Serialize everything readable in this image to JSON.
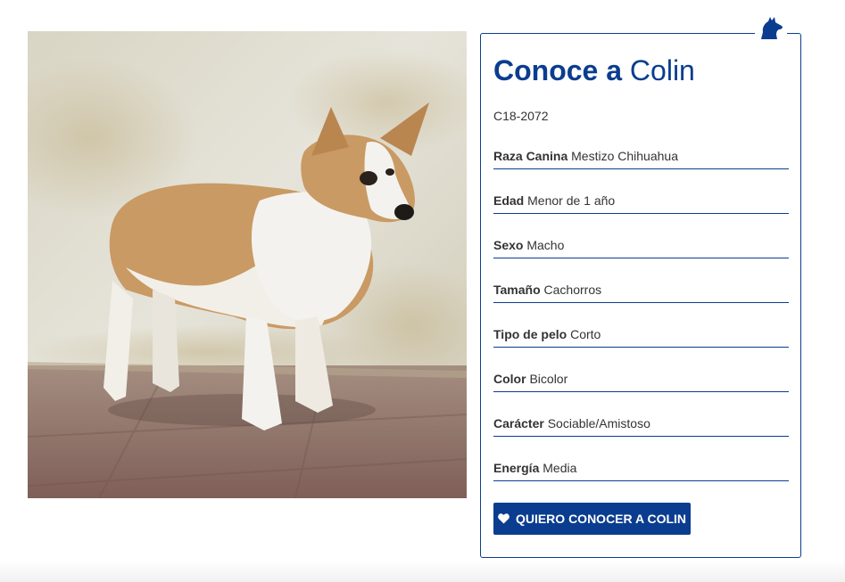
{
  "page": {
    "title_bold": "Conoce a",
    "title_name": "Colin",
    "code": "C18-2072"
  },
  "photo": {
    "subject": "dog-photo"
  },
  "attributes": [
    {
      "key": "Raza Canina",
      "value": "Mestizo Chihuahua"
    },
    {
      "key": "Edad",
      "value": "Menor de 1 año"
    },
    {
      "key": "Sexo",
      "value": "Macho"
    },
    {
      "key": "Tamaño",
      "value": "Cachorros"
    },
    {
      "key": "Tipo de pelo",
      "value": "Corto"
    },
    {
      "key": "Color",
      "value": "Bicolor"
    },
    {
      "key": "Carácter",
      "value": "Sociable/Amistoso"
    },
    {
      "key": "Energía",
      "value": "Media"
    }
  ],
  "cta": {
    "label": "QUIERO CONOCER A COLIN",
    "icon": "heart-icon"
  },
  "icons": {
    "card_corner": "dog-head-icon"
  },
  "colors": {
    "brand": "#0a3d8f",
    "text": "#333333"
  }
}
